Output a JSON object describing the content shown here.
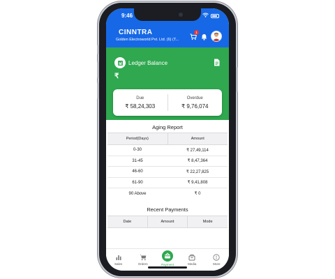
{
  "status_bar": {
    "time": "9:46"
  },
  "header": {
    "brand": "CINNTRA",
    "company": "Golden Electroworld Pvt. Ltd. (6) (T...",
    "cart_count": "1"
  },
  "ledger": {
    "title": "Ledger Balance",
    "amount": "₹",
    "due_label": "Due",
    "due_value": "₹ 58,24,303",
    "overdue_label": "Overdue",
    "overdue_value": "₹ 9,76,074"
  },
  "aging": {
    "title": "Aging Report",
    "columns": [
      "Period(Days)",
      "Amount"
    ],
    "rows": [
      {
        "period": "0-30",
        "amount": "₹ 27,49,114"
      },
      {
        "period": "31-45",
        "amount": "₹ 8,47,364"
      },
      {
        "period": "46-60",
        "amount": "₹ 22,27,825"
      },
      {
        "period": "61-90",
        "amount": "₹ 9,41,808"
      },
      {
        "period": "90 Above",
        "amount": "₹ 0"
      }
    ]
  },
  "recent_payments": {
    "title": "Recent Payments",
    "columns": [
      "Date",
      "Amount",
      "Mode"
    ]
  },
  "nav": {
    "items": [
      {
        "label": "Sales",
        "icon": "bar-chart-icon"
      },
      {
        "label": "Orders",
        "icon": "cart-icon"
      },
      {
        "label": "Payment",
        "icon": "payment-icon"
      },
      {
        "label": "Media",
        "icon": "media-icon"
      },
      {
        "label": "More",
        "icon": "more-icon"
      }
    ]
  },
  "colors": {
    "primary_blue": "#1768e6",
    "accent_green": "#2fa84f"
  }
}
